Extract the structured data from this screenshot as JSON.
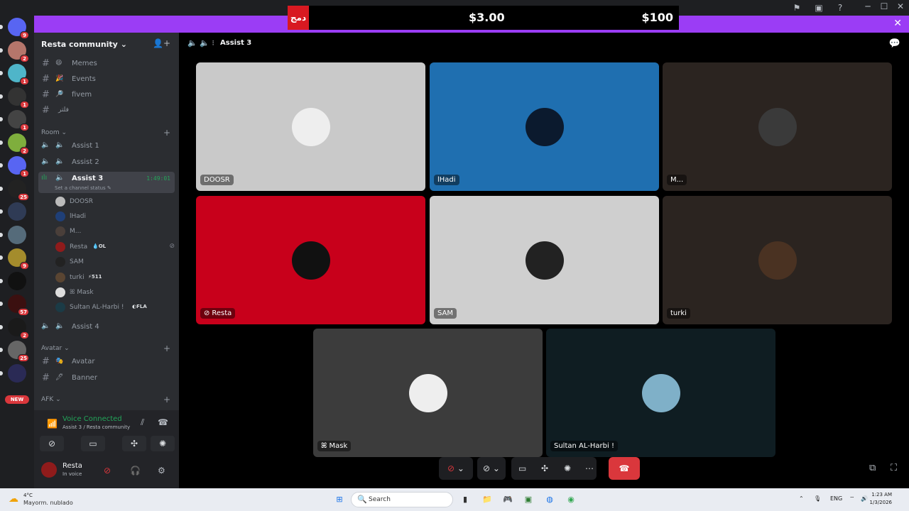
{
  "banner": {
    "ad_red_text": "دمج",
    "price1": "$3.00",
    "price2": "$100"
  },
  "servers": [
    {
      "badge": "9"
    },
    {
      "badge": "2"
    },
    {
      "badge": "1"
    },
    {
      "badge": "1"
    },
    {
      "badge": "1"
    },
    {
      "badge": "2"
    },
    {
      "badge": "1"
    },
    {
      "badge": "25"
    },
    {
      "badge": ""
    },
    {
      "badge": ""
    },
    {
      "badge": "9"
    },
    {
      "badge": ""
    },
    {
      "badge": "57"
    },
    {
      "badge": "2"
    },
    {
      "badge": "25"
    },
    {
      "badge": ""
    }
  ],
  "servers_new_label": "NEW",
  "guild": {
    "name": "Resta community"
  },
  "channels_top": [
    {
      "emoji": "😄",
      "label": "Memes"
    },
    {
      "emoji": "🎉",
      "label": "Events"
    },
    {
      "emoji": "🔎",
      "label": "fivem"
    },
    {
      "emoji": "",
      "label": "فلتر"
    }
  ],
  "categories": {
    "room": "Room",
    "avatar": "Avatar",
    "afk": "AFK"
  },
  "voice_channels": [
    {
      "label": "Assist 1"
    },
    {
      "label": "Assist 2"
    },
    {
      "label": "Assist 3",
      "timer": "1:49:01",
      "status": "Set a channel status"
    },
    {
      "label": "Assist 4"
    }
  ],
  "voice_users": [
    {
      "name": "DOOSR",
      "tag": ""
    },
    {
      "name": "lHadi",
      "tag": ""
    },
    {
      "name": "M...",
      "tag": ""
    },
    {
      "name": "Resta",
      "tag": "OL"
    },
    {
      "name": "SAM",
      "tag": ""
    },
    {
      "name": "turki",
      "tag": "511"
    },
    {
      "name": "ꕤ Mask",
      "tag": ""
    },
    {
      "name": "Sultan AL-Harbi ! ",
      "tag": "FLA"
    }
  ],
  "avatar_channels": [
    {
      "emoji": "🎭",
      "label": "Avatar"
    },
    {
      "emoji": "🖊",
      "label": "Banner"
    }
  ],
  "voice_panel": {
    "title": "Voice Connected",
    "subtitle": "Assist 3 / Resta community"
  },
  "user": {
    "name": "Resta",
    "status": "In voice"
  },
  "stage": {
    "title": "Assist 3"
  },
  "tiles": [
    {
      "name": "DOOSR",
      "bg": "#c9c9c9",
      "muted": false
    },
    {
      "name": "lHadi",
      "bg": "#1f6fb0",
      "muted": false
    },
    {
      "name": "M...",
      "bg": "#2b2420",
      "muted": false
    },
    {
      "name": "Resta",
      "bg": "#c8001b",
      "muted": true
    },
    {
      "name": "SAM",
      "bg": "#cfcfcf",
      "muted": false
    },
    {
      "name": "turki",
      "bg": "#2b2420",
      "muted": false
    },
    {
      "name": "ꕤ Mask",
      "bg": "#3c3c3c",
      "muted": false
    },
    {
      "name": "Sultan AL-Harbi ! ",
      "bg": "#0f1d22",
      "muted": false
    }
  ],
  "taskbar": {
    "temp": "4°C",
    "weather": "Mayorm. nublado",
    "search": "Search",
    "lang": "ENG",
    "time": "1:23 AM",
    "date": "1/3/2026"
  }
}
